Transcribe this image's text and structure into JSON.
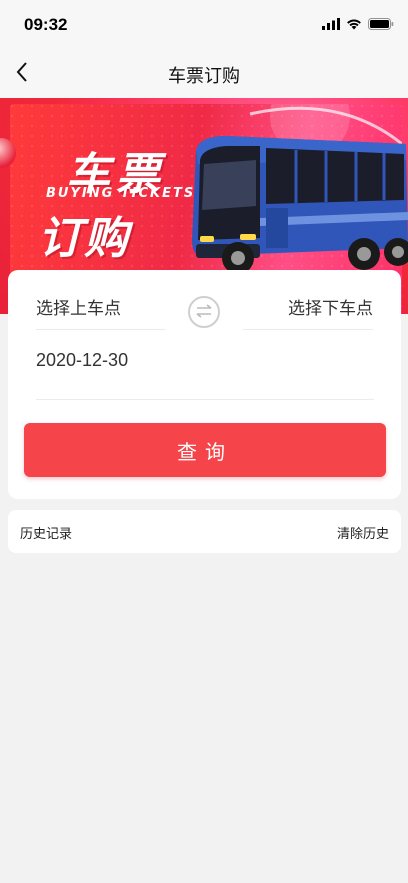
{
  "status_bar": {
    "time": "09:32"
  },
  "nav": {
    "title": "车票订购"
  },
  "banner": {
    "title_line1": "车票",
    "subtitle": "BUYING TICKETS",
    "title_line2": "订购"
  },
  "ticket_form": {
    "from_placeholder": "选择上车点",
    "to_placeholder": "选择下车点",
    "date": "2020-12-30",
    "query_label": "查询"
  },
  "history": {
    "label": "历史记录",
    "clear_label": "清除历史"
  },
  "colors": {
    "accent": "#f5444a",
    "background": "#f2f2f2"
  }
}
